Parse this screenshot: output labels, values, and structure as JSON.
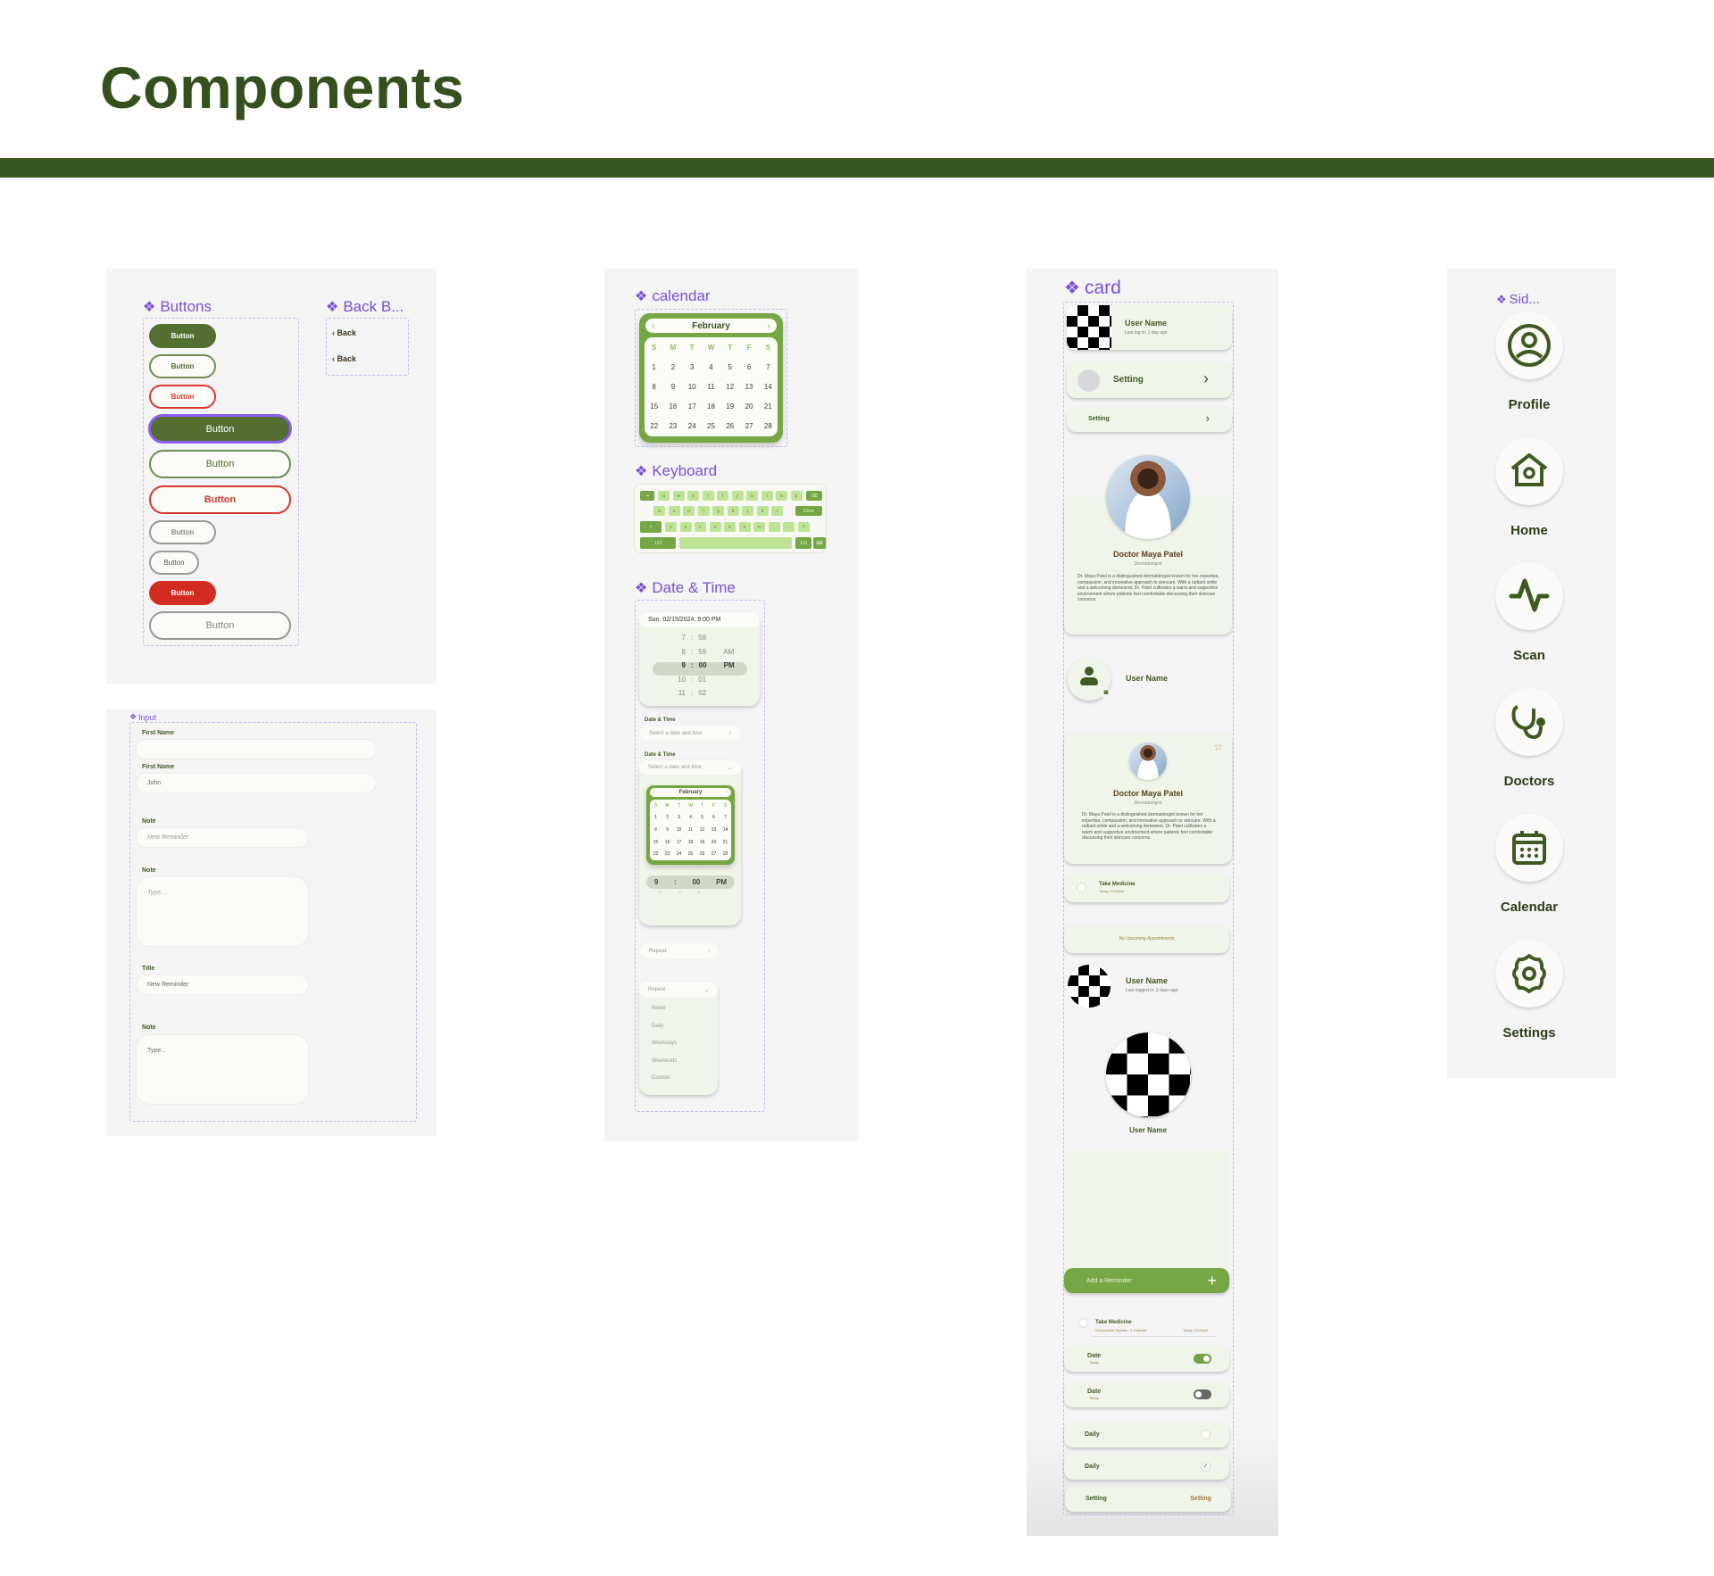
{
  "page": {
    "title": "Components"
  },
  "colors": {
    "primary": "#526f31",
    "header_bar": "#38561d",
    "danger": "#d22c21",
    "accent_purple": "#7b4fd8",
    "light_green": "#75a744"
  },
  "buttons_panel": {
    "title": "Buttons",
    "buttons": [
      {
        "label": "Button",
        "variant": "filled-small"
      },
      {
        "label": "Button",
        "variant": "outline-green-small"
      },
      {
        "label": "Button",
        "variant": "outline-red-small"
      },
      {
        "label": "Button",
        "variant": "filled-large-focused"
      },
      {
        "label": "Button",
        "variant": "outline-green-large"
      },
      {
        "label": "Button",
        "variant": "outline-red-large"
      },
      {
        "label": "Button",
        "variant": "outline-grey-small"
      },
      {
        "label": "Button",
        "variant": "outline-grey-xsmall"
      },
      {
        "label": "Button",
        "variant": "filled-red-small"
      },
      {
        "label": "Button",
        "variant": "outline-grey-large"
      }
    ]
  },
  "back_panel": {
    "title": "Back B...",
    "items": [
      "‹ Back",
      "‹ Back"
    ]
  },
  "input_panel": {
    "title": "Input",
    "fields": [
      {
        "label": "First Name",
        "value": "",
        "placeholder": ""
      },
      {
        "label": "First Name",
        "value": "John"
      },
      {
        "label": "Note",
        "placeholder": "New Reminder"
      },
      {
        "label": "Note",
        "placeholder": "Type..."
      },
      {
        "label": "Title",
        "value": "New Reminder"
      },
      {
        "label": "Note",
        "value": "Type..."
      }
    ]
  },
  "calendar": {
    "title": "calendar",
    "month": "February",
    "weekdays": [
      "S",
      "M",
      "T",
      "W",
      "T",
      "F",
      "S"
    ],
    "days": [
      "1",
      "2",
      "3",
      "4",
      "5",
      "6",
      "7",
      "8",
      "9",
      "10",
      "11",
      "12",
      "13",
      "14",
      "15",
      "16",
      "17",
      "18",
      "19",
      "20",
      "21",
      "22",
      "23",
      "24",
      "25",
      "26",
      "27",
      "28"
    ]
  },
  "keyboard": {
    "title": "Keyboard",
    "row1": [
      "q",
      "w",
      "e",
      "r",
      "t",
      "y",
      "u",
      "i",
      "o",
      "p"
    ],
    "row2": [
      "a",
      "s",
      "d",
      "f",
      "g",
      "h",
      "j",
      "k",
      "l"
    ],
    "row3": [
      "z",
      "x",
      "c",
      "v",
      "b",
      "n",
      "m",
      ",",
      ".",
      "?"
    ],
    "done_label": "Done",
    "num_label": "123"
  },
  "date_time": {
    "title": "Date & Time",
    "picker_header": "Sun. 02/15/2024, 9:00 PM",
    "wheel": [
      {
        "h": "7",
        "m": "58",
        "p": ""
      },
      {
        "h": "8",
        "m": "59",
        "p": "AM"
      },
      {
        "h": "9",
        "m": "00",
        "p": "PM"
      },
      {
        "h": "10",
        "m": "01",
        "p": ""
      },
      {
        "h": "11",
        "m": "02",
        "p": ""
      }
    ],
    "field_label": "Date & Time",
    "field_placeholder": "Select a date and time",
    "time_selected": {
      "h": "9",
      "m": "00",
      "p": "PM"
    },
    "repeat_label": "Repeat",
    "repeat_options": [
      "Never",
      "Daily",
      "Weekdays",
      "Weekends",
      "Custom"
    ]
  },
  "card_panel": {
    "title": "card",
    "user_card": {
      "name": "User Name",
      "sub": "Last log in: 1 day ago"
    },
    "setting_large": "Setting",
    "setting_small": "Setting",
    "doctor": {
      "name": "Doctor Maya Patel",
      "specialty": "Dermatologist",
      "desc": "Dr. Maya Patel is a distinguished dermatologist known for her expertise, compassion, and innovative approach to skincare. With a radiant smile and a welcoming demeanor, Dr. Patel cultivates a warm and supportive environment where patients feel comfortable discussing their skincare concerns."
    },
    "avatar_user": "User Name",
    "medicine": {
      "title": "Take Medicine",
      "sub": "Today, 12:00pm"
    },
    "no_appointments": "No Upcoming Appointments",
    "user2": {
      "name": "User Name",
      "sub": "Last logged in: 2 days ago"
    },
    "user3": "User Name",
    "add_reminder": "Add a Reminder",
    "medicine2": {
      "title": "Take Medicine",
      "sub": "Doxycycline Hyclate - 1 Capsule",
      "time": "Today, 12:00pm"
    },
    "date_on": {
      "title": "Date",
      "sub": "Today",
      "toggle": true
    },
    "date_off": {
      "title": "Date",
      "sub": "Today",
      "toggle": false
    },
    "daily_unchecked": {
      "label": "Daily",
      "checked": false
    },
    "daily_checked": {
      "label": "Daily",
      "checked": true
    },
    "setting_row": {
      "left": "Setting",
      "right": "Setting"
    }
  },
  "sidebar_panel": {
    "title": "Sid...",
    "items": [
      {
        "label": "Profile",
        "icon": "profile-icon"
      },
      {
        "label": "Home",
        "icon": "home-icon"
      },
      {
        "label": "Scan",
        "icon": "pulse-icon"
      },
      {
        "label": "Doctors",
        "icon": "stethoscope-icon"
      },
      {
        "label": "Calendar",
        "icon": "calendar-icon"
      },
      {
        "label": "Settings",
        "icon": "gear-icon"
      }
    ]
  }
}
